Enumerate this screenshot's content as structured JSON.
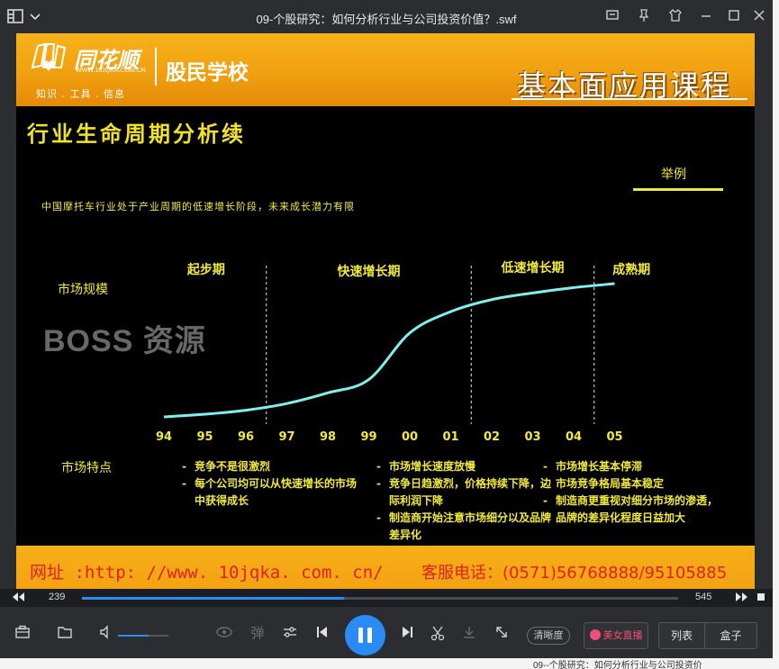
{
  "window": {
    "title": "09-个股研究：如何分析行业与公司投资价值？.swf"
  },
  "slide": {
    "brand_name": "同花顺",
    "brand_url": "WWW.10JQKA.COM.CN",
    "brand_slogan": "知识 . 工具 . 信息",
    "school": "股民学校",
    "course": "基本面应用课程",
    "title": "行业生命周期分析续",
    "example_label": "举例",
    "subtitle": "中国摩托车行业处于产业周期的低速增长阶段，未来成长潜力有限",
    "watermark": "BOSS 资源",
    "footer_url": "网址 :http: //www. 10jqka. com. cn/",
    "footer_phone": "客服电话：(0571)56768888/95105885"
  },
  "chart_data": {
    "type": "line",
    "ylabel": "市场规模",
    "categories": [
      "94",
      "95",
      "96",
      "97",
      "98",
      "99",
      "00",
      "01",
      "02",
      "03",
      "04",
      "05"
    ],
    "series": [
      {
        "values": [
          0.0,
          0.02,
          0.05,
          0.1,
          0.18,
          0.28,
          0.63,
          0.79,
          0.88,
          0.93,
          0.97,
          1.0
        ]
      }
    ],
    "phases": [
      {
        "label": "起步期",
        "boundary_after": "96"
      },
      {
        "label": "快速增长期",
        "boundary_after": "01"
      },
      {
        "label": "低速增长期",
        "boundary_after": "04"
      },
      {
        "label": "成熟期"
      }
    ],
    "features_label": "市场特点",
    "features": [
      [
        "竞争不是很激烈",
        "每个公司均可以从快速增长的市场中获得成长"
      ],
      [
        "市场增长速度放慢",
        "竞争日趋激烈，价格持续下降，边际利润下降",
        "制造商开始注意市场细分以及品牌差异化"
      ],
      [
        "市场增长基本停滞",
        "市场竞争格局基本稳定",
        "制造商更重视对细分市场的渗透，品牌的差异化程度日益加大"
      ]
    ],
    "colors": {
      "line": "#7ff0ee",
      "text": "#f2ea38",
      "background": "#000000"
    },
    "grid": false
  },
  "player": {
    "current_time": "239",
    "total_time": "545",
    "progress": 0.44,
    "volume": 0.6,
    "danmaku_label": "弹",
    "clarity_label": "清晰度",
    "live_label": "美女直播",
    "list_label": "列表",
    "box_label": "盒子"
  },
  "desktop": {
    "bottom_text": "09--个股研究：如何分析行业与公司投资价"
  }
}
